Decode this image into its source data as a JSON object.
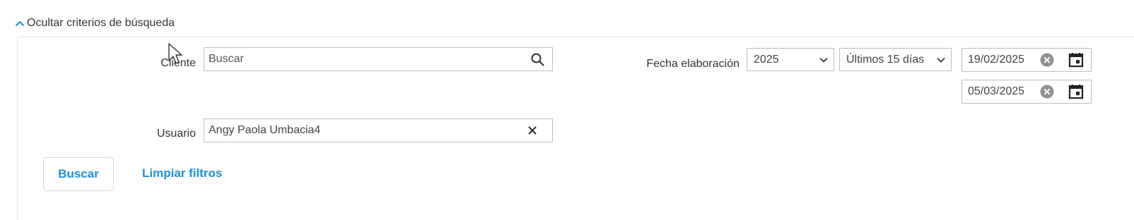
{
  "section_toggle": {
    "label": "Ocultar criterios de búsqueda",
    "icon": "chevron-up-icon"
  },
  "filters": {
    "cliente": {
      "label": "Cliente",
      "placeholder": "Buscar",
      "value": "",
      "icon": "search-icon"
    },
    "usuario": {
      "label": "Usuario",
      "value": "Angy Paola Umbacia4",
      "icon": "close-icon"
    },
    "fecha_elaboracion": {
      "label": "Fecha elaboración",
      "year": "2025",
      "range": "Últimos 15 días",
      "date_from": "19/02/2025",
      "date_to": "05/03/2025"
    }
  },
  "actions": {
    "search_label": "Buscar",
    "clear_label": "Limpiar filtros"
  },
  "colors": {
    "accent": "#1a8fd8",
    "border": "#bdbdbd",
    "icon": "#333333"
  }
}
